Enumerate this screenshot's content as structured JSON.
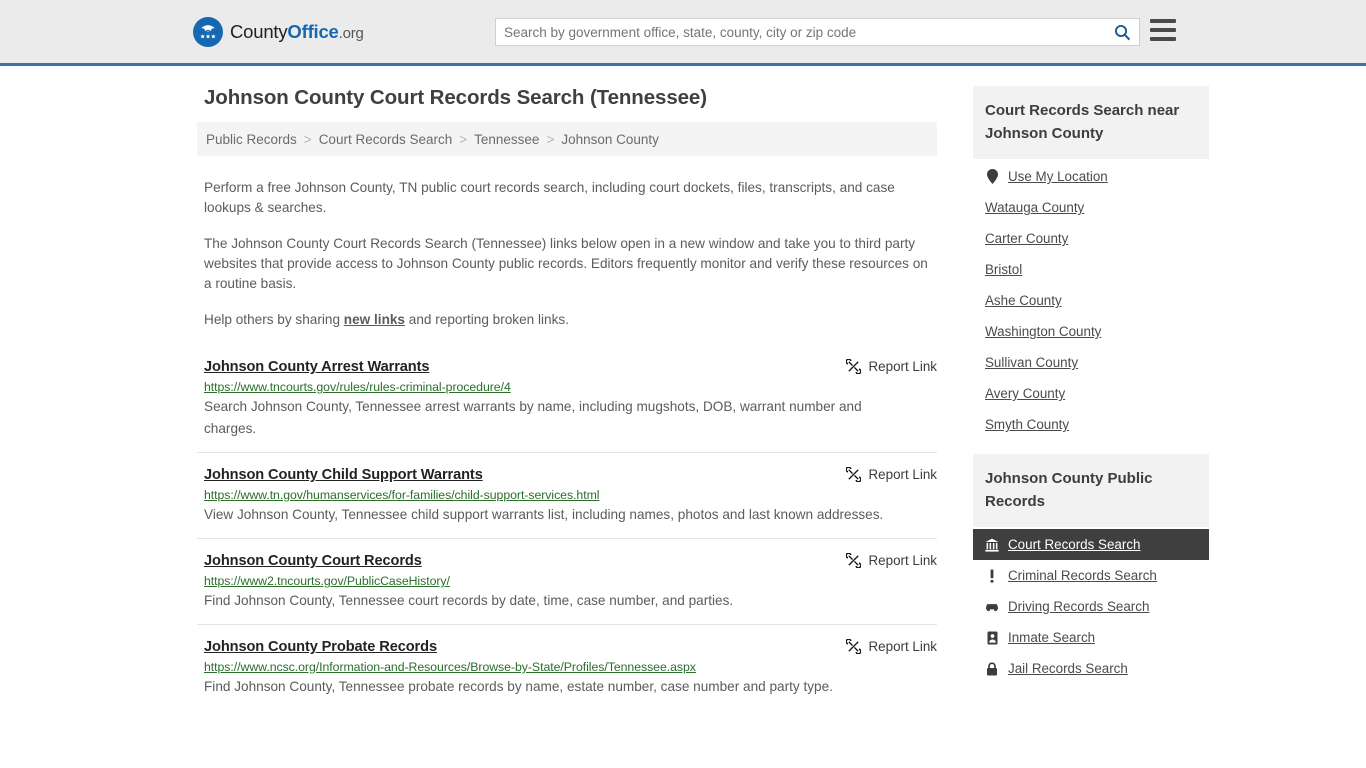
{
  "header": {
    "logo": {
      "part1": "County",
      "part2": "Office",
      "part3": ".org",
      "icon": "eagle-seal-icon",
      "brand_color": "#1668b3"
    },
    "search": {
      "placeholder": "Search by government office, state, county, city or zip code",
      "value": "",
      "icon": "search-icon"
    },
    "menu_icon": "hamburger-menu-icon",
    "background": "#ebebeb",
    "border_color": "#3b73a8"
  },
  "page": {
    "title": "Johnson County Court Records Search (Tennessee)",
    "breadcrumb": [
      {
        "label": "Public Records"
      },
      {
        "label": "Court Records Search"
      },
      {
        "label": "Tennessee"
      },
      {
        "label": "Johnson County"
      }
    ],
    "breadcrumb_separator": ">",
    "intro": {
      "p1": "Perform a free Johnson County, TN public court records search, including court dockets, files, transcripts, and case lookups & searches.",
      "p2": "The Johnson County Court Records Search (Tennessee) links below open in a new window and take you to third party websites that provide access to Johnson County public records. Editors frequently monitor and verify these resources on a routine basis.",
      "p3_before": "Help others by sharing ",
      "p3_link": "new links",
      "p3_after": " and reporting broken links."
    }
  },
  "results": {
    "report_label": "Report Link",
    "report_icon": "broken-link-icon",
    "items": [
      {
        "title": "Johnson County Arrest Warrants",
        "url": "https://www.tncourts.gov/rules/rules-criminal-procedure/4",
        "description": "Search Johnson County, Tennessee arrest warrants by name, including mugshots, DOB, warrant number and charges."
      },
      {
        "title": "Johnson County Child Support Warrants",
        "url": "https://www.tn.gov/humanservices/for-families/child-support-services.html",
        "description": "View Johnson County, Tennessee child support warrants list, including names, photos and last known addresses."
      },
      {
        "title": "Johnson County Court Records",
        "url": "https://www2.tncourts.gov/PublicCaseHistory/",
        "description": "Find Johnson County, Tennessee court records by date, time, case number, and parties."
      },
      {
        "title": "Johnson County Probate Records",
        "url": "https://www.ncsc.org/Information-and-Resources/Browse-by-State/Profiles/Tennessee.aspx",
        "description": "Find Johnson County, Tennessee probate records by name, estate number, case number and party type."
      }
    ]
  },
  "sidebar": {
    "nearby": {
      "heading": "Court Records Search near Johnson County",
      "items": [
        {
          "label": "Use My Location",
          "icon": "map-pin-icon"
        },
        {
          "label": "Watauga County",
          "icon": ""
        },
        {
          "label": "Carter County",
          "icon": ""
        },
        {
          "label": "Bristol",
          "icon": ""
        },
        {
          "label": "Ashe County",
          "icon": ""
        },
        {
          "label": "Washington County",
          "icon": ""
        },
        {
          "label": "Sullivan County",
          "icon": ""
        },
        {
          "label": "Avery County",
          "icon": ""
        },
        {
          "label": "Smyth County",
          "icon": ""
        }
      ]
    },
    "public_records": {
      "heading": "Johnson County Public Records",
      "items": [
        {
          "label": "Court Records Search",
          "icon": "courthouse-icon",
          "active": true
        },
        {
          "label": "Criminal Records Search",
          "icon": "exclamation-icon",
          "active": false
        },
        {
          "label": "Driving Records Search",
          "icon": "car-icon",
          "active": false
        },
        {
          "label": "Inmate Search",
          "icon": "id-badge-icon",
          "active": false
        },
        {
          "label": "Jail Records Search",
          "icon": "lock-icon",
          "active": false
        }
      ]
    },
    "active_highlight": "#3f3f3f"
  }
}
